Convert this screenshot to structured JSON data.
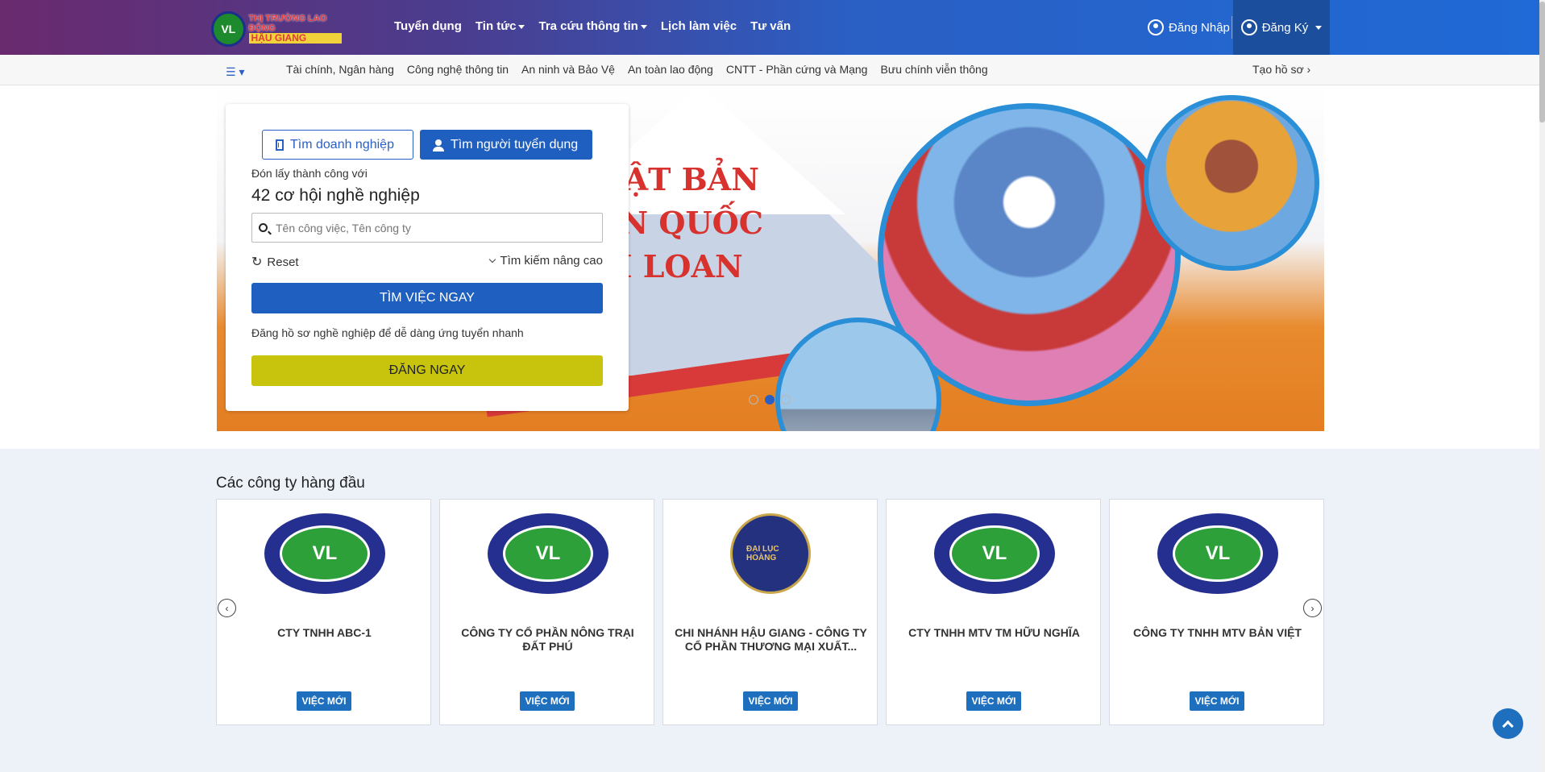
{
  "logo": {
    "line1": "THỊ TRƯỜNG LAO ĐỘNG",
    "line2": "HẬU GIANG",
    "mark": "VL"
  },
  "nav": {
    "items": [
      {
        "label": "Tuyển dụng",
        "dropdown": false
      },
      {
        "label": "Tin tức",
        "dropdown": true
      },
      {
        "label": "Tra cứu thông tin",
        "dropdown": true
      },
      {
        "label": "Lịch làm việc",
        "dropdown": false
      },
      {
        "label": "Tư vấn",
        "dropdown": false
      }
    ],
    "login": "Đăng Nhập",
    "register": "Đăng Ký"
  },
  "categories": {
    "items": [
      "Tài chính, Ngân hàng",
      "Công nghệ thông tin",
      "An ninh và Bảo Vệ",
      "An toàn lao động",
      "CNTT - Phần cứng và Mạng",
      "Bưu chính viễn thông"
    ],
    "create_cv": "Tạo hồ sơ"
  },
  "hero": {
    "banner_lines": [
      "NHẬT BẢN",
      "HÀN QUỐC",
      "ĐÀI LOAN"
    ],
    "slide_count": 3,
    "active_slide": 2
  },
  "search": {
    "tab_company": "Tìm doanh nghiệp",
    "tab_recruiter": "Tìm người tuyển dụng",
    "intro": "Đón lấy thành công với",
    "headline": "42 cơ hội nghề nghiệp",
    "placeholder": "Tên công việc, Tên công ty",
    "reset": "Reset",
    "advanced": "Tìm kiếm nâng cao",
    "find_button": "TÌM VIỆC NGAY",
    "cv_note": "Đăng hồ sơ nghề nghiệp để dễ dàng ứng tuyển nhanh",
    "register_button": "ĐĂNG NGAY"
  },
  "companies": {
    "title": "Các công ty hàng đầu",
    "badge": "VIỆC MỚI",
    "items": [
      {
        "name": "CTY TNHH ABC-1",
        "logo": "VL"
      },
      {
        "name": "CÔNG TY CỔ PHẦN NÔNG TRẠI ĐẤT PHÚ",
        "logo": "VL"
      },
      {
        "name": "CHI NHÁNH HẬU GIANG - CÔNG TY CỔ PHẦN THƯƠNG MẠI XUẤT...",
        "logo": "ĐẠI LỤC HOÀNG"
      },
      {
        "name": "CTY TNHH MTV TM HỮU NGHĨA",
        "logo": "VL"
      },
      {
        "name": "CÔNG TY TNHH MTV BẢN VIỆT",
        "logo": "VL"
      }
    ]
  },
  "colors": {
    "primary": "#1f5fbf",
    "accent_yellow": "#c8c40e",
    "section_bg": "#edf2f9"
  }
}
